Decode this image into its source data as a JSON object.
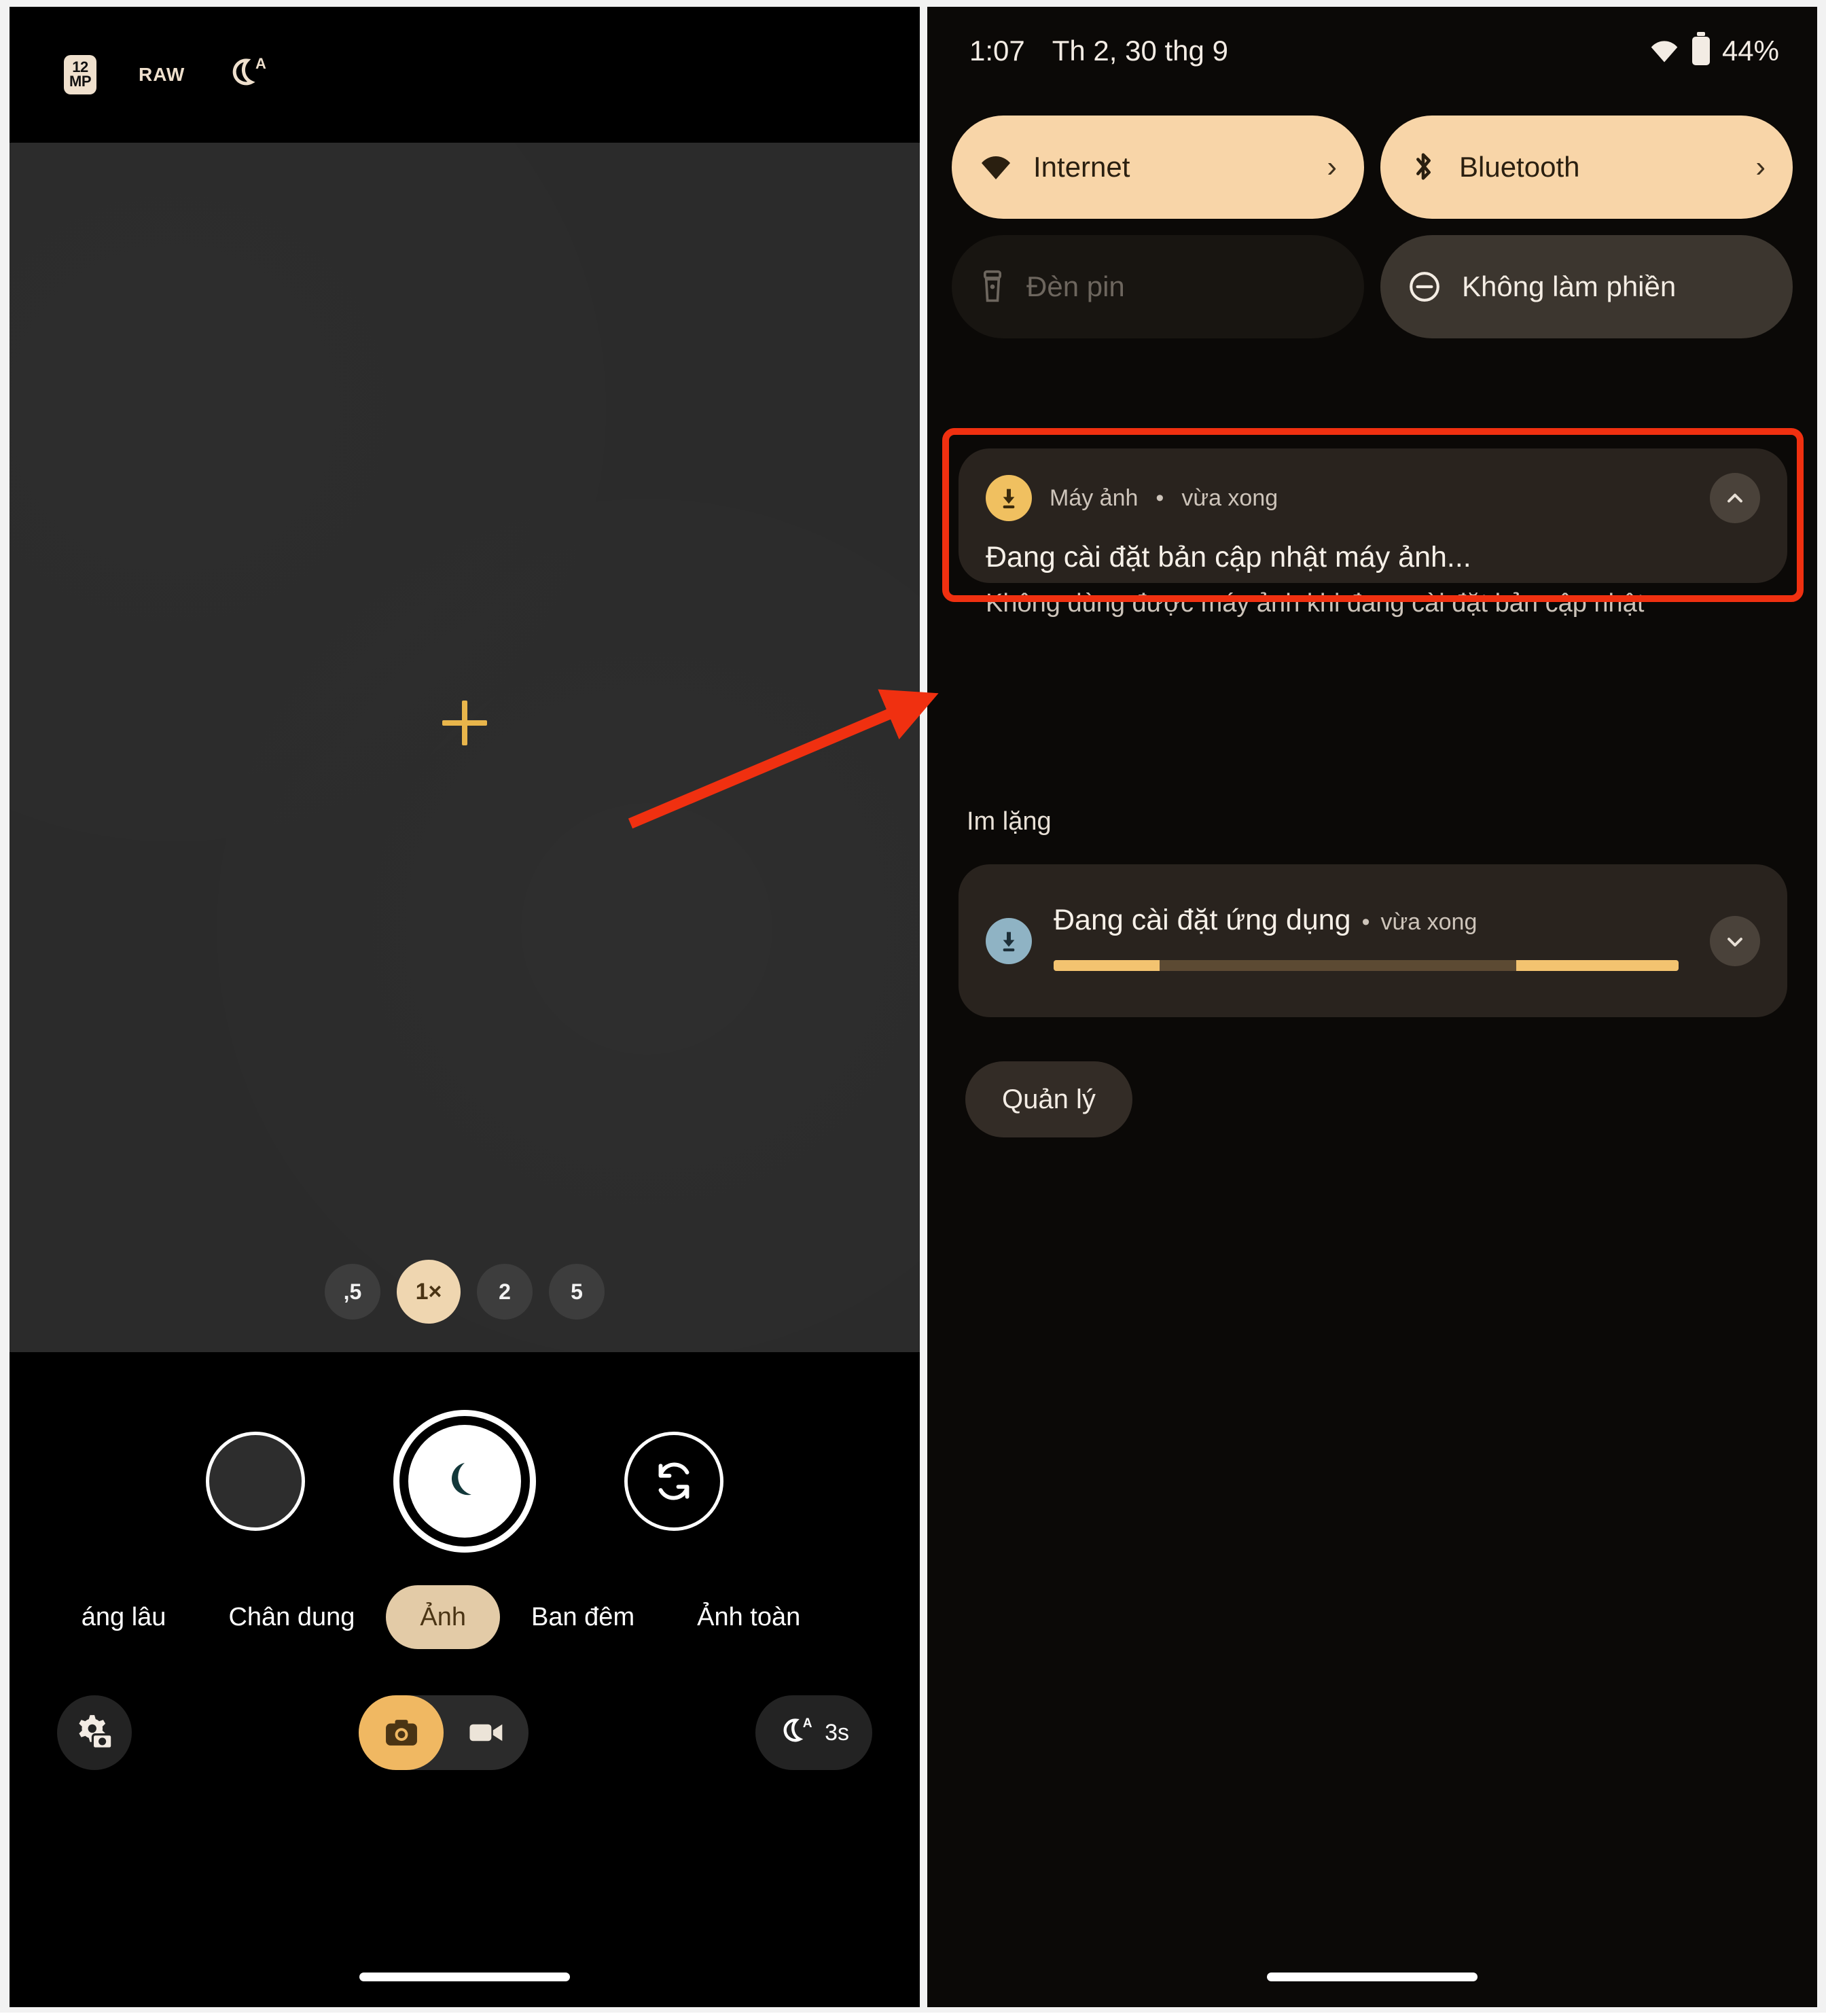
{
  "camera": {
    "topbar": {
      "mp_badge_top": "12",
      "mp_badge_bottom": "MP",
      "raw_label": "RAW",
      "night_auto_icon": "moon-auto-icon"
    },
    "focus_indicator": "focus-crosshair",
    "zoom_levels": [
      {
        "label": ",5",
        "active": false
      },
      {
        "label": "1×",
        "active": true
      },
      {
        "label": "2",
        "active": false
      },
      {
        "label": "5",
        "active": false
      }
    ],
    "shutter": {
      "gallery_thumb_name": "gallery-thumbnail",
      "shutter_icon": "moon-icon",
      "flip_icon": "camera-flip-icon"
    },
    "modes": [
      {
        "label": "áng lâu",
        "active": false,
        "clipped": true
      },
      {
        "label": "Chân dung",
        "active": false,
        "clipped": false
      },
      {
        "label": "Ảnh",
        "active": true,
        "clipped": false
      },
      {
        "label": "Ban đêm",
        "active": false,
        "clipped": false
      },
      {
        "label": "Ảnh toàn ",
        "active": false,
        "clipped": true
      }
    ],
    "footer": {
      "settings_icon": "camera-settings-gear-icon",
      "photo_icon": "camera-icon",
      "video_icon": "video-camera-icon",
      "night_timer_label": "3s",
      "night_timer_icon": "moon-auto-icon"
    }
  },
  "shade": {
    "status_bar": {
      "time": "1:07",
      "date": "Th 2, 30 thg 9",
      "wifi_icon": "wifi-icon",
      "battery_icon": "battery-icon",
      "battery_percent": "44%"
    },
    "quick_settings": [
      {
        "label": "Internet",
        "icon": "wifi-icon",
        "state": "on",
        "has_chevron": true,
        "chevron": "›"
      },
      {
        "label": "Bluetooth",
        "icon": "bluetooth-icon",
        "state": "on",
        "has_chevron": true,
        "chevron": "›"
      },
      {
        "label": "Đèn pin",
        "icon": "flashlight-icon",
        "state": "off-dark",
        "has_chevron": false,
        "chevron": ""
      },
      {
        "label": "Không làm phiền",
        "icon": "do-not-disturb-icon",
        "state": "off-grey",
        "has_chevron": false,
        "chevron": ""
      }
    ],
    "notifications": [
      {
        "app_name": "Máy ảnh",
        "separator": "•",
        "time": "vừa xong",
        "title": "Đang cài đặt bản cập nhật máy ảnh...",
        "body": "Không dùng được máy ảnh khi đang cài đặt bản cập nhật",
        "icon": "download-icon",
        "icon_color": "#f0c060",
        "chevron": "collapse-chevron-up",
        "highlighted": true
      }
    ],
    "silent_section_label": "Im lặng",
    "silent_notification": {
      "title": "Đang cài đặt ứng dụng",
      "separator": "•",
      "time": "vừa xong",
      "icon": "download-icon",
      "icon_color": "#8fb3c4",
      "chevron": "expand-chevron-down",
      "progress": {
        "segments": [
          [
            0,
            17
          ],
          [
            74,
            100
          ]
        ],
        "track_color": "#5c4a33",
        "fill_color": "#f3c370"
      }
    },
    "manage_button": "Quản lý",
    "nav_pill": "home-gesture-pill"
  },
  "annotation": {
    "highlight_color": "#f03010",
    "arrow_name": "pointer-arrow",
    "box_name": "highlight-box"
  }
}
